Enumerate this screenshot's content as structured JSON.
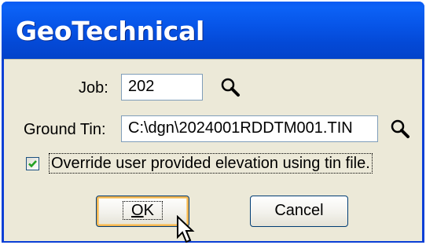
{
  "window": {
    "title": "GeoTechnical"
  },
  "job": {
    "label": "Job:",
    "value": "202"
  },
  "ground_tin": {
    "label": "Ground Tin:",
    "value": "C:\\dgn\\2024001RDDTM001.TIN"
  },
  "override": {
    "label": "Override user provided elevation using tin file.",
    "checked": true
  },
  "buttons": {
    "ok_first": "O",
    "ok_rest": "K",
    "cancel": "Cancel"
  },
  "icons": {
    "browse": "magnifier-icon",
    "cursor": "mouse-pointer-icon"
  },
  "colors": {
    "title_bar": "#0755e8",
    "dialog_bg": "#ece9d8",
    "check": "#21a121",
    "default_btn_glow": "#f2b552"
  }
}
